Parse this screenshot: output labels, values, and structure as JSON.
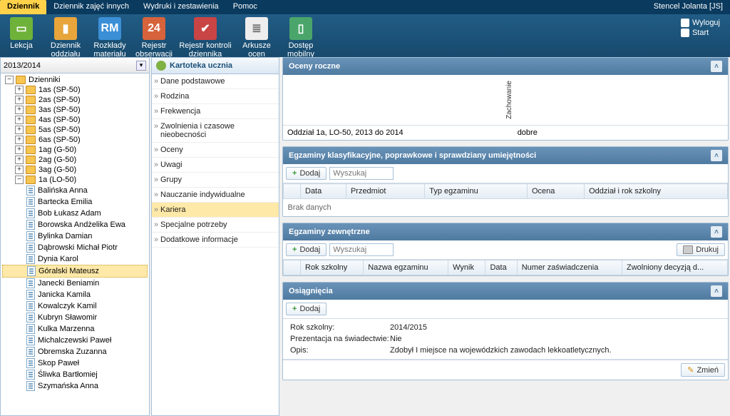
{
  "header": {
    "tabs": [
      "Dziennik",
      "Dziennik zajęć innych",
      "Wydruki i zestawienia",
      "Pomoc"
    ],
    "active_tab": 0,
    "user": "Stencel Jolanta [JS]",
    "logout": "Wyloguj",
    "start": "Start"
  },
  "ribbon": [
    {
      "label": "Lekcja",
      "color": "#6fb23a"
    },
    {
      "label": "Dziennik oddziału",
      "color": "#e7a53b"
    },
    {
      "label": "Rozkłady materiału",
      "color": "#3b8fd6",
      "text": "RM"
    },
    {
      "label": "Rejestr obserwacji",
      "color": "#d6633b",
      "text": "24"
    },
    {
      "label": "Rejestr kontroli dziennika",
      "color": "#c94444"
    },
    {
      "label": "Arkusze ocen",
      "color": "#eeeeee"
    },
    {
      "label": "Dostęp mobilny",
      "color": "#4aa56a"
    }
  ],
  "year": "2013/2014",
  "tree": {
    "root": "Dzienniki",
    "classes": [
      "1as (SP-50)",
      "2as (SP-50)",
      "3as (SP-50)",
      "4as (SP-50)",
      "5as (SP-50)",
      "6as (SP-50)",
      "1ag (G-50)",
      "2ag (G-50)",
      "3ag (G-50)"
    ],
    "open_class": "1a (LO-50)",
    "students": [
      "Balińska Anna",
      "Bartecka Emilia",
      "Bob Łukasz Adam",
      "Borowska Andżelika Ewa",
      "Bylinka Damian",
      "Dąbrowski Michał Piotr",
      "Dynia Karol",
      "Góralski Mateusz",
      "Janecki Beniamin",
      "Janicka Kamila",
      "Kowalczyk Kamil",
      "Kubryn Sławomir",
      "Kulka Marzenna",
      "Michalczewski Paweł",
      "Obremska Zuzanna",
      "Skop Paweł",
      "Śliwka Bartłomiej",
      "Szymańska Anna"
    ],
    "selected_student": "Góralski Mateusz"
  },
  "kartoteka": {
    "title": "Kartoteka ucznia",
    "items": [
      "Dane podstawowe",
      "Rodzina",
      "Frekwencja",
      "Zwolnienia i czasowe nieobecności",
      "Oceny",
      "Uwagi",
      "Grupy",
      "Nauczanie indywidualne",
      "Kariera",
      "Specjalne potrzeby",
      "Dodatkowe informacje"
    ],
    "selected": "Kariera"
  },
  "oceny": {
    "title": "Oceny roczne",
    "zach_label": "Zachowanie",
    "oddzial": "Oddział 1a, LO-50, 2013 do 2014",
    "value": "dobre"
  },
  "egz_klas": {
    "title": "Egzaminy klasyfikacyjne, poprawkowe i sprawdziany umiejętności",
    "add": "Dodaj",
    "search_ph": "Wyszukaj",
    "cols": [
      "Data",
      "Przedmiot",
      "Typ egzaminu",
      "Ocena",
      "Oddział i rok szkolny"
    ],
    "empty": "Brak danych"
  },
  "egz_zew": {
    "title": "Egzaminy zewnętrzne",
    "add": "Dodaj",
    "search_ph": "Wyszukaj",
    "print": "Drukuj",
    "cols": [
      "Rok szkolny",
      "Nazwa egzaminu",
      "Wynik",
      "Data",
      "Numer zaświadczenia",
      "Zwolniony decyzją d..."
    ]
  },
  "osiag": {
    "title": "Osiągnięcia",
    "add": "Dodaj",
    "rows": [
      {
        "k": "Rok szkolny:",
        "v": "2014/2015"
      },
      {
        "k": "Prezentacja na świadectwie:",
        "v": "Nie"
      },
      {
        "k": "Opis:",
        "v": "Zdobył I miejsce na wojewódzkich zawodach lekkoatletycznych."
      }
    ],
    "edit": "Zmień"
  }
}
